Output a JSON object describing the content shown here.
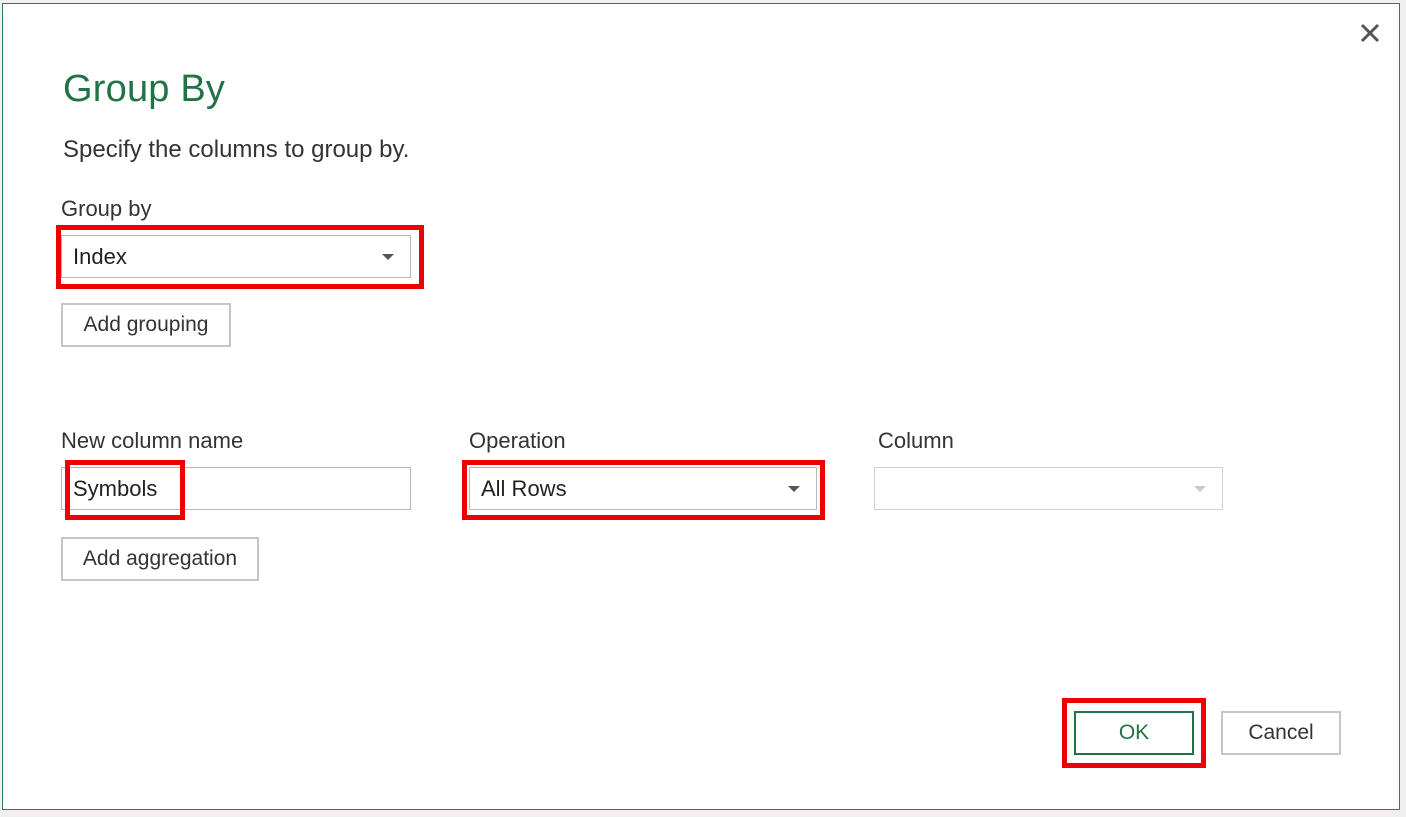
{
  "dialog": {
    "title": "Group By",
    "subtitle": "Specify the columns to group by."
  },
  "group_by": {
    "label": "Group by",
    "selected": "Index",
    "add_button": "Add grouping"
  },
  "aggregation": {
    "new_column_label": "New column name",
    "new_column_value": "Symbols",
    "operation_label": "Operation",
    "operation_selected": "All Rows",
    "column_label": "Column",
    "column_selected": "",
    "add_button": "Add aggregation"
  },
  "footer": {
    "ok_label": "OK",
    "cancel_label": "Cancel"
  },
  "icons": {
    "close": "close-icon",
    "dropdown": "chevron-down-icon"
  },
  "colors": {
    "accent": "#217346",
    "highlight": "#ee0000"
  }
}
